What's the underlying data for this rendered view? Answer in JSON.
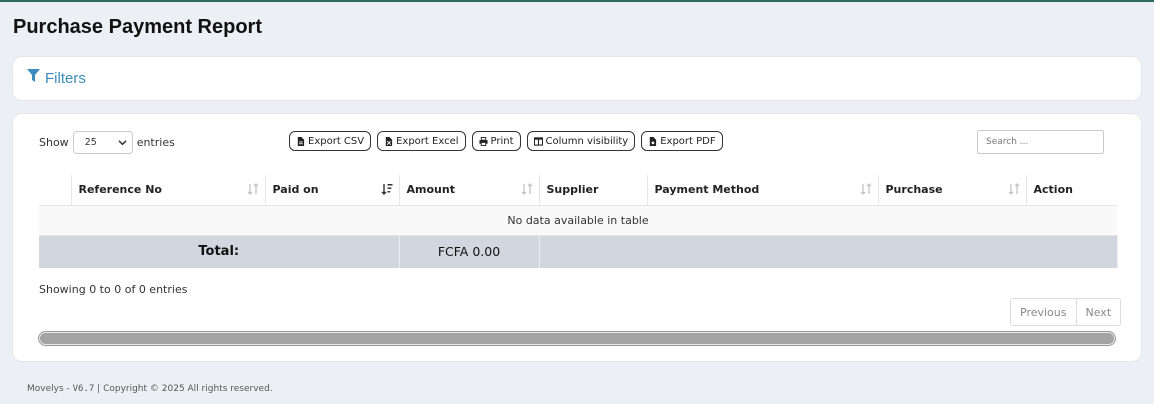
{
  "page": {
    "title": "Purchase Payment Report"
  },
  "filters": {
    "label": "Filters"
  },
  "length": {
    "show": "Show",
    "value": "25",
    "entries": "entries"
  },
  "buttons": {
    "csv": "Export CSV",
    "excel": "Export Excel",
    "print": "Print",
    "colvis": "Column visibility",
    "pdf": "Export PDF"
  },
  "search": {
    "placeholder": "Search ..."
  },
  "table": {
    "columns": [
      "",
      "Reference No",
      "Paid on",
      "Amount",
      "Supplier",
      "Payment Method",
      "Purchase",
      "Action"
    ],
    "empty": "No data available in table",
    "total_label": "Total:",
    "total_value": "FCFA 0.00"
  },
  "info": "Showing 0 to 0 of 0 entries",
  "pager": {
    "prev": "Previous",
    "next": "Next"
  },
  "footer": {
    "app": "Movelys - ",
    "version": "V6.7",
    "rest": " | Copyright © 2025 All rights reserved."
  },
  "colors": {
    "accent": "#3c8dbc",
    "background": "#ecf0f5",
    "total_row": "#d2d6de"
  }
}
